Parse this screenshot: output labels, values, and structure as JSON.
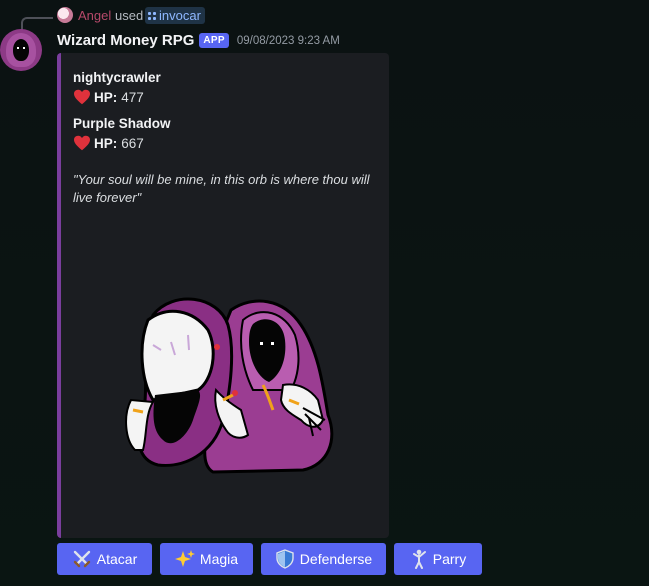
{
  "reply": {
    "user": "Angel",
    "used_text": "used",
    "command": "invocar"
  },
  "message": {
    "bot_name": "Wizard Money RPG",
    "tag": "APP",
    "timestamp": "09/08/2023 9:23 AM"
  },
  "embed": {
    "accent_color": "#7a3e9d",
    "fields": [
      {
        "name": "nightycrawler",
        "hp_label": "HP:",
        "hp_value": "477",
        "icon": "heart-icon"
      },
      {
        "name": "Purple Shadow",
        "hp_label": "HP:",
        "hp_value": "667",
        "icon": "heart-icon"
      }
    ],
    "quote": "\"Your soul will be mine, in this orb is where thou will live forever\""
  },
  "buttons": [
    {
      "label": "Atacar",
      "icon": "crossed-swords-icon"
    },
    {
      "label": "Magia",
      "icon": "sparkles-icon"
    },
    {
      "label": "Defenderse",
      "icon": "shield-icon"
    },
    {
      "label": "Parry",
      "icon": "fencer-icon"
    }
  ],
  "colors": {
    "blurple": "#5865f2",
    "reply_user": "#b7496a",
    "heart": "#e0323c"
  }
}
